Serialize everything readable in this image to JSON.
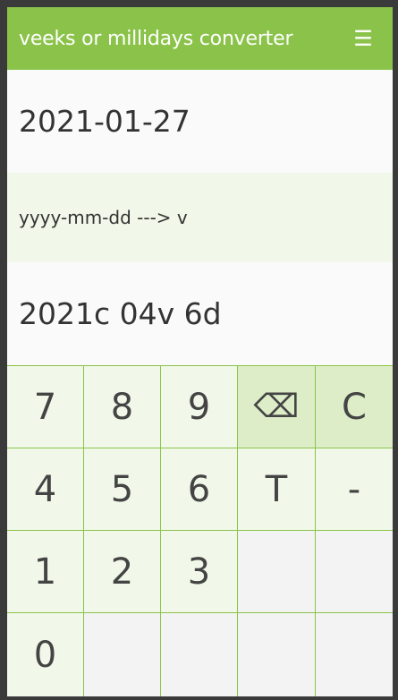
{
  "header": {
    "title": "veeks or millidays converter",
    "menu_icon": "☰"
  },
  "input": {
    "value": "2021-01-27"
  },
  "mode": {
    "label": "yyyy-mm-dd ---> v"
  },
  "output": {
    "value": "2021c 04v 6d"
  },
  "keypad": {
    "k7": "7",
    "k8": "8",
    "k9": "9",
    "backspace": "⌫",
    "clear": "C",
    "k4": "4",
    "k5": "5",
    "k6": "6",
    "today": "T",
    "minus": "-",
    "k1": "1",
    "k2": "2",
    "k3": "3",
    "k0": "0"
  },
  "colors": {
    "accent": "#8bc34a",
    "light_green": "#f1f8e9",
    "action_green": "#dcedc8"
  }
}
